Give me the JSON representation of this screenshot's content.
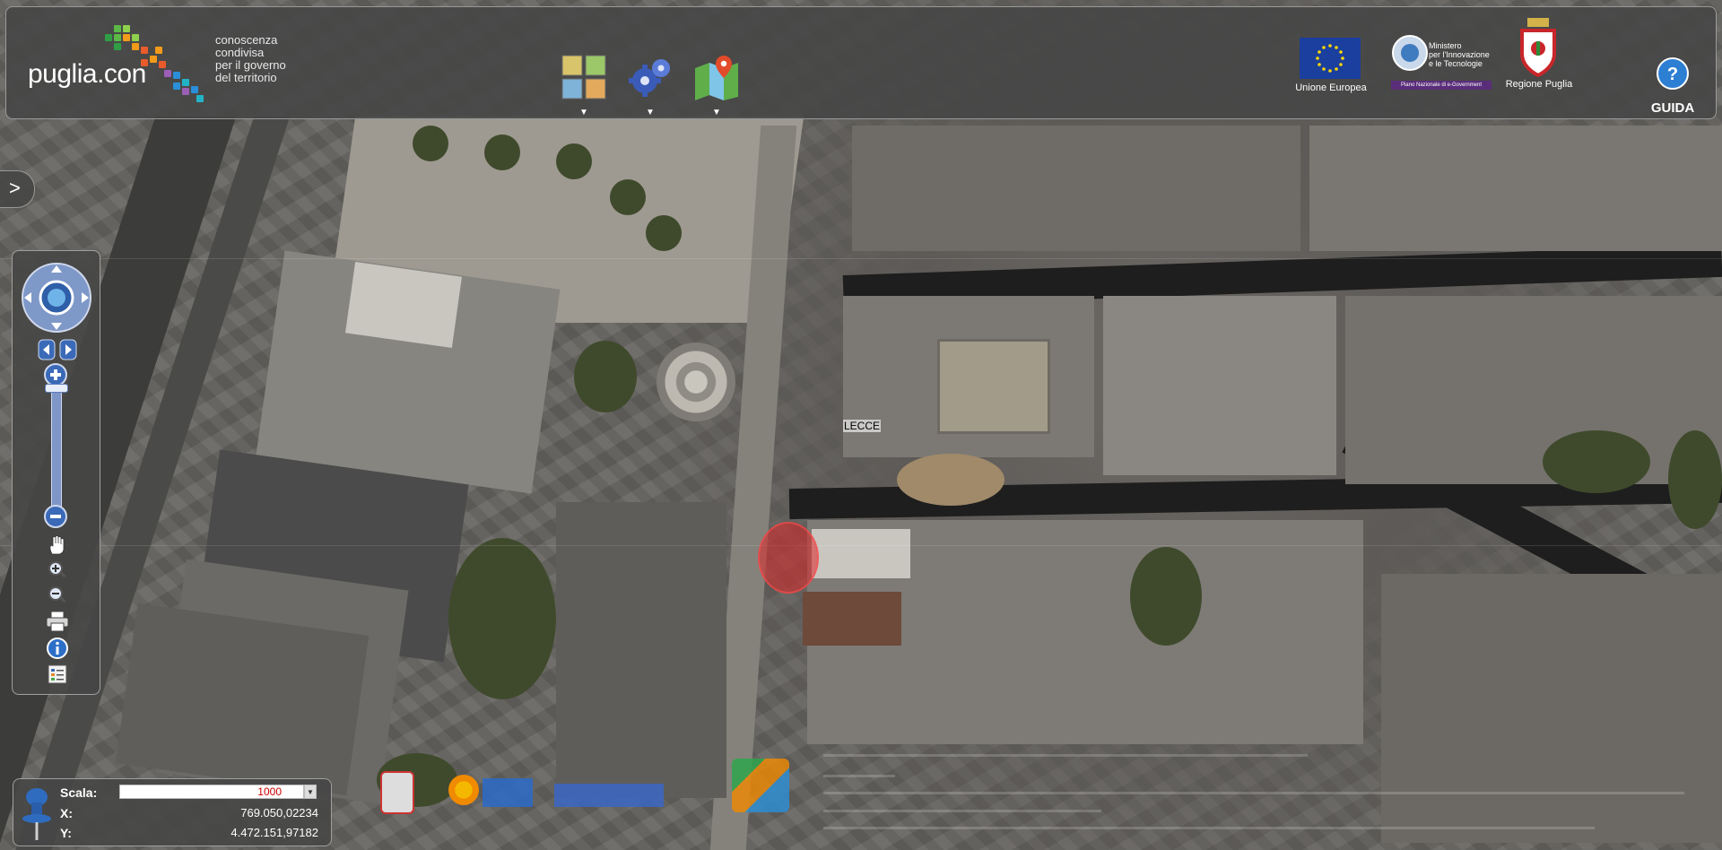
{
  "header": {
    "logo_text": "puglia.con",
    "tagline": "conoscenza\ncondivisa\nper il governo\ndel territorio",
    "tools": [
      {
        "name": "layers",
        "icon": "layers-icon"
      },
      {
        "name": "settings",
        "icon": "gears-icon"
      },
      {
        "name": "map",
        "icon": "map-pin-icon"
      }
    ],
    "tool_arrow": "▼",
    "partners": {
      "eu_label": "Unione Europea",
      "ministry_text": "Ministero\nper l'Innovazione\ne le Tecnologie",
      "ministry_bar": "Piano Nazionale di e-Government",
      "region_label": "Regione Puglia"
    },
    "guida_label": "GUIDA"
  },
  "side_toggle": ">",
  "map": {
    "city_label": "LECCE"
  },
  "coords": {
    "scale_label": "Scala:",
    "scale_value": "1000",
    "x_label": "X:",
    "x_value": "769.050,02234",
    "y_label": "Y:",
    "y_value": "4.472.151,97182"
  },
  "colors": {
    "panel_bg": "#464646",
    "eu_blue": "#1b3f9e",
    "marker_red": "#dc2828",
    "guida_blue": "#2d7fd3"
  }
}
